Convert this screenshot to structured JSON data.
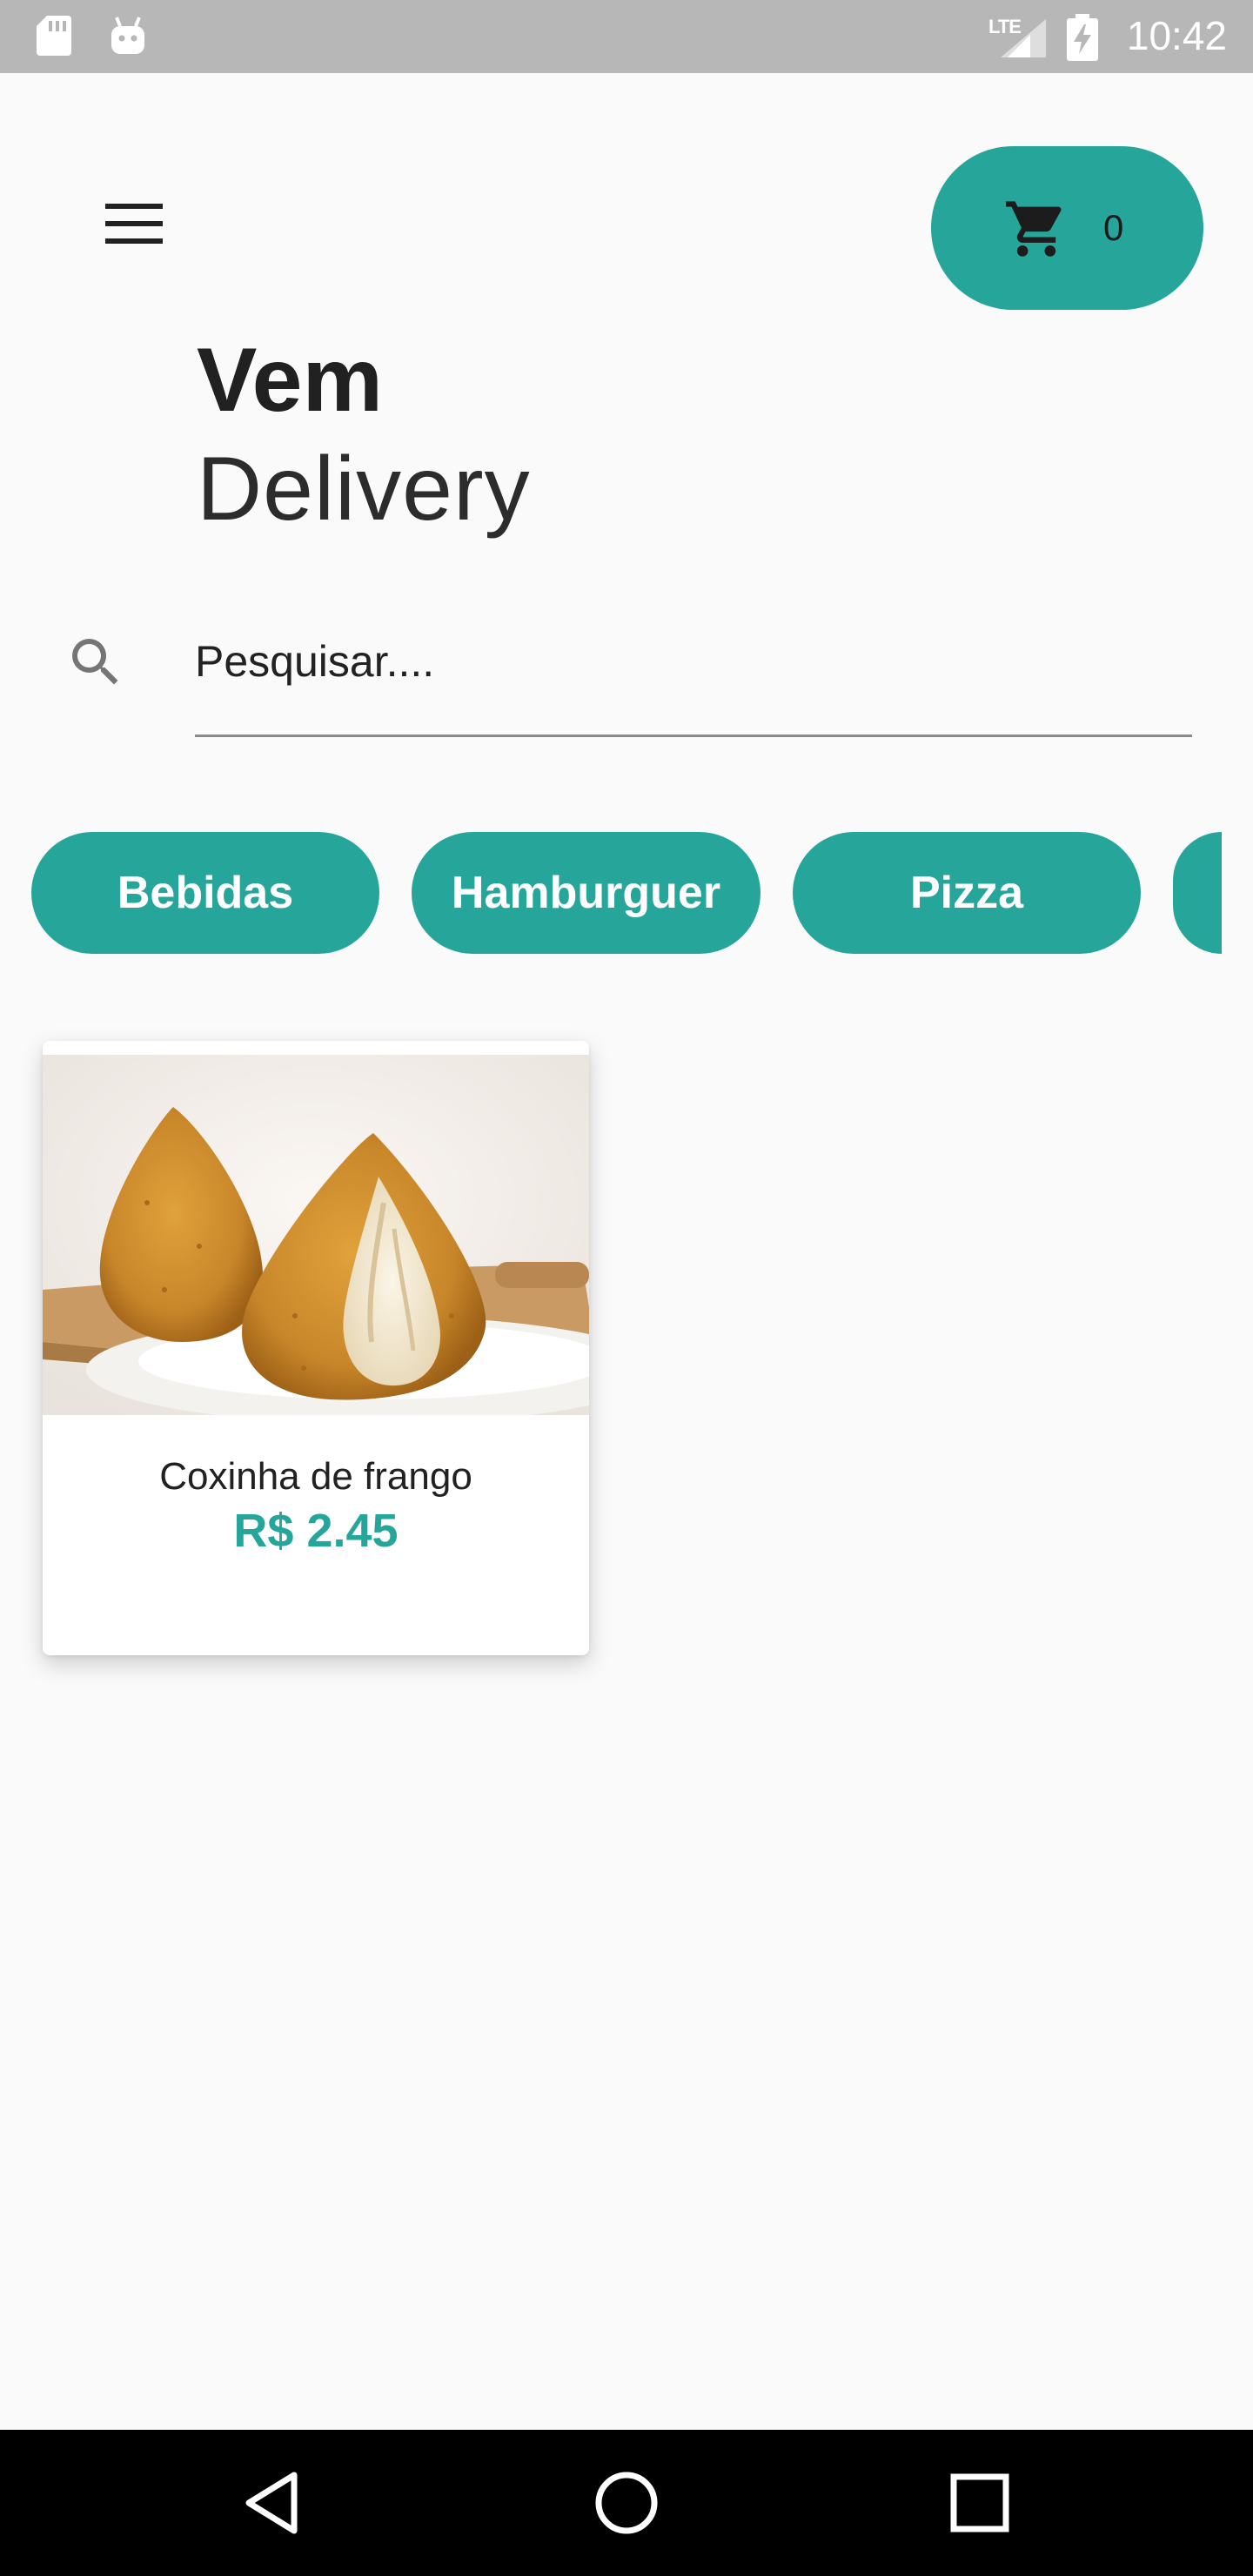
{
  "status_bar": {
    "time": "10:42",
    "network": "LTE",
    "icons": [
      "sd-card-icon",
      "android-icon",
      "signal-icon",
      "battery-charging-icon"
    ]
  },
  "header": {
    "cart_count": "0",
    "title_main": "Vem",
    "title_sub": "Delivery"
  },
  "search": {
    "placeholder": "Pesquisar...."
  },
  "categories": [
    {
      "label": "Bebidas"
    },
    {
      "label": "Hamburguer"
    },
    {
      "label": "Pizza"
    },
    {
      "label": ""
    }
  ],
  "products": [
    {
      "name": "Coxinha de frango",
      "price": "R$ 2.45"
    }
  ],
  "colors": {
    "accent": "#26a69a",
    "background": "#fafafa",
    "status_bar": "#b7b7b7",
    "text": "#212121"
  }
}
